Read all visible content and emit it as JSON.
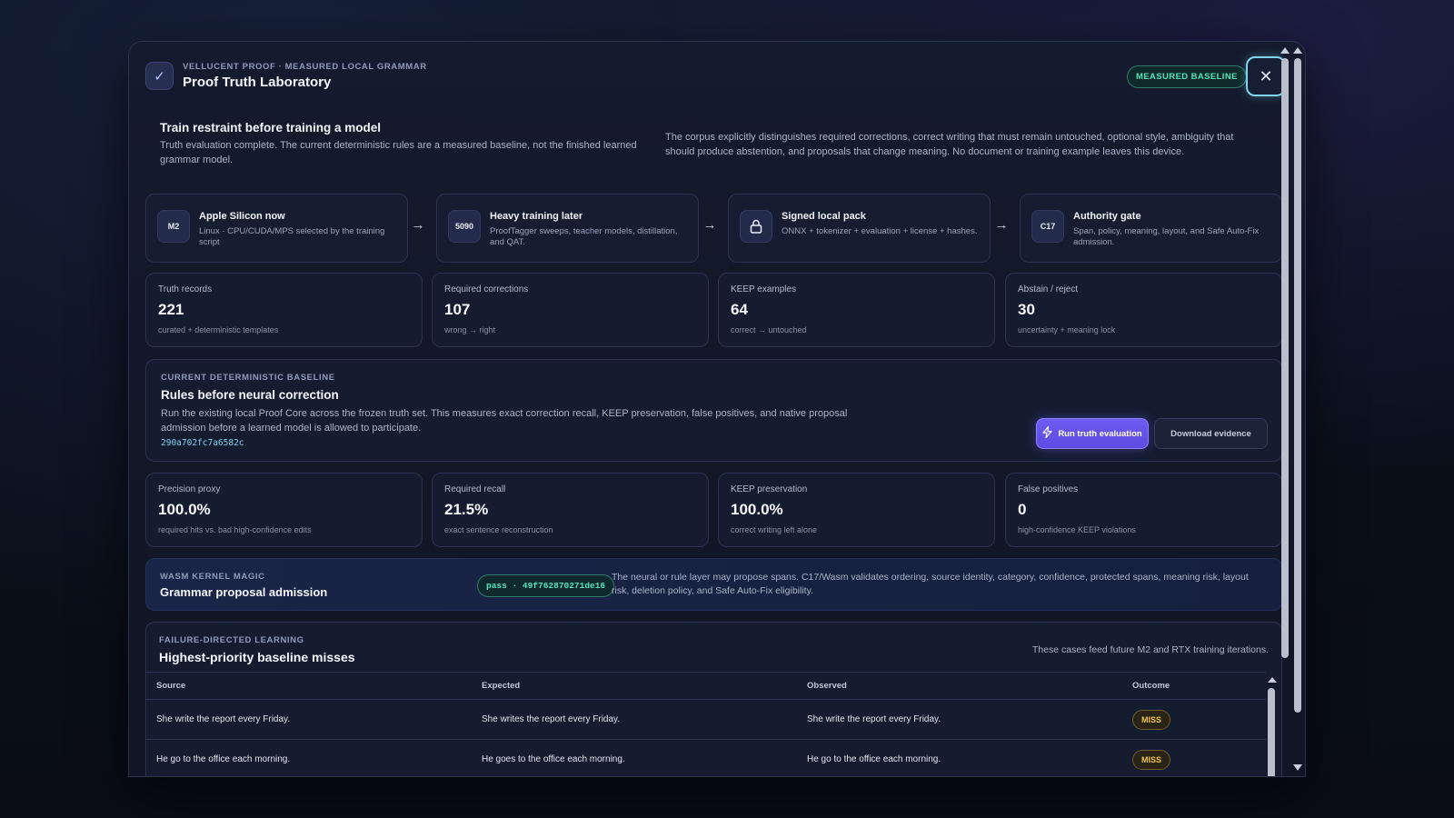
{
  "header": {
    "eyebrow": "VELLUCENT PROOF · MEASURED LOCAL GRAMMAR",
    "title": "Proof Truth Laboratory",
    "badge": "MEASURED BASELINE",
    "close_icon": "close-icon"
  },
  "intro": {
    "title": "Train restraint before training a model",
    "left": "Truth evaluation complete. The current deterministic rules are a measured baseline, not the finished learned grammar model.",
    "right": "The corpus explicitly distinguishes required corrections, correct writing that must remain untouched, optional style, ambiguity that should produce abstention, and proposals that change meaning. No document or training example leaves this device."
  },
  "pipeline": [
    {
      "badge": "M2",
      "title": "Apple Silicon now",
      "desc": "Linux · CPU/CUDA/MPS selected by the training script"
    },
    {
      "badge": "5090",
      "title": "Heavy training later",
      "desc": "ProofTagger sweeps, teacher models, distillation, and QAT."
    },
    {
      "badge": "",
      "icon": "lock-icon",
      "title": "Signed local pack",
      "desc": "ONNX + tokenizer + evaluation + license + hashes."
    },
    {
      "badge": "C17",
      "title": "Authority gate",
      "desc": "Span, policy, meaning, layout, and Safe Auto-Fix admission."
    }
  ],
  "truth_stats": [
    {
      "label": "Truth records",
      "value": "221",
      "sub": "curated + deterministic templates"
    },
    {
      "label": "Required corrections",
      "value": "107",
      "sub": "wrong → right"
    },
    {
      "label": "KEEP examples",
      "value": "64",
      "sub": "correct → untouched"
    },
    {
      "label": "Abstain / reject",
      "value": "30",
      "sub": "uncertainty + meaning lock"
    }
  ],
  "baseline": {
    "eyebrow": "CURRENT DETERMINISTIC BASELINE",
    "title": "Rules before neural correction",
    "desc": "Run the existing local Proof Core across the frozen truth set. This measures exact correction recall, KEEP preservation, false positives, and native proposal admission before a learned model is allowed to participate.",
    "hash": "290a702fc7a6582c",
    "run_label": "Run truth evaluation",
    "download_label": "Download evidence"
  },
  "metrics": [
    {
      "label": "Precision proxy",
      "value": "100.0%",
      "sub": "required hits vs. bad high-confidence edits"
    },
    {
      "label": "Required recall",
      "value": "21.5%",
      "sub": "exact sentence reconstruction"
    },
    {
      "label": "KEEP preservation",
      "value": "100.0%",
      "sub": "correct writing left alone"
    },
    {
      "label": "False positives",
      "value": "0",
      "sub": "high-confidence KEEP violations"
    }
  ],
  "wasm": {
    "eyebrow": "WASM KERNEL MAGIC",
    "title": "Grammar proposal admission",
    "pass": "pass · 49f762870271de16",
    "desc": "The neural or rule layer may propose spans. C17/Wasm validates ordering, source identity, category, confidence, protected spans, meaning risk, layout risk, deletion policy, and Safe Auto-Fix eligibility."
  },
  "failures": {
    "eyebrow": "FAILURE-DIRECTED LEARNING",
    "title": "Highest-priority baseline misses",
    "note": "These cases feed future M2 and RTX training iterations.",
    "columns": [
      "Source",
      "Expected",
      "Observed",
      "Outcome"
    ],
    "rows": [
      {
        "source": "She write the report every Friday.",
        "expected": "She writes the report every Friday.",
        "observed": "She write the report every Friday.",
        "outcome": "MISS"
      },
      {
        "source": "He go to the office each morning.",
        "expected": "He goes to the office each morning.",
        "observed": "He go to the office each morning.",
        "outcome": "MISS"
      }
    ]
  },
  "colors": {
    "accent": "#6f5cf2",
    "success": "#55e3b9",
    "warning": "#f3c450",
    "focus_ring": "#7fd4f0"
  }
}
